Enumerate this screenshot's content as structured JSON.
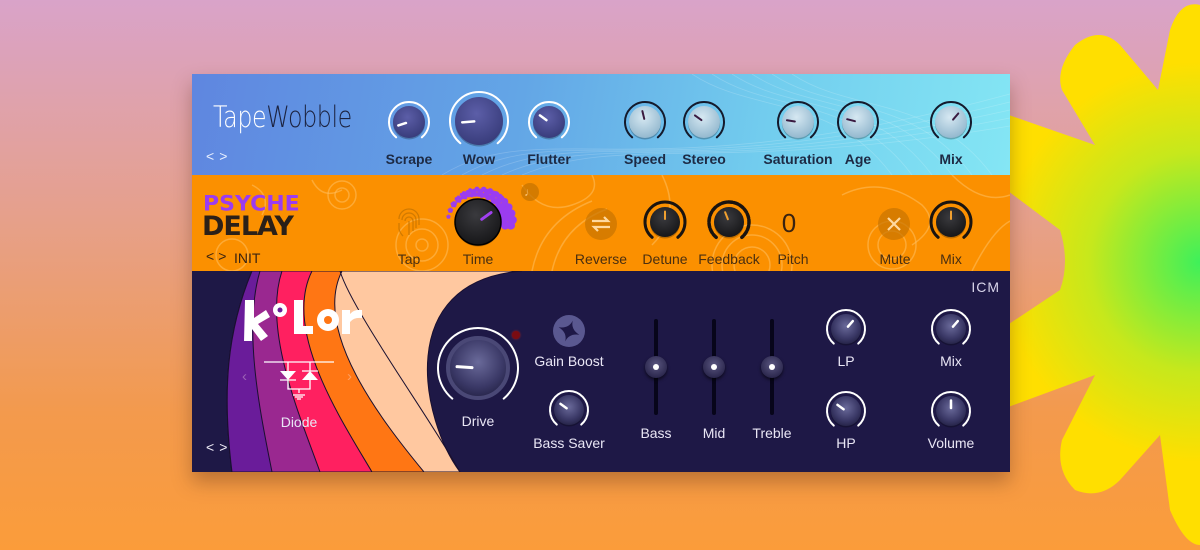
{
  "background": {
    "gradient_top": "#d9a3c9",
    "gradient_bottom": "#fb9c3a",
    "decoration": "yellow-green-star-shape"
  },
  "tapewobble": {
    "title_part1": "Tape",
    "title_part2": "Wobble",
    "nav_prev": "<",
    "nav_next": ">",
    "accent": "#63a6e6",
    "knobs": [
      {
        "id": "scrape",
        "label": "Scrape",
        "value": 0.1
      },
      {
        "id": "wow",
        "label": "Wow",
        "value": 0.15
      },
      {
        "id": "flutter",
        "label": "Flutter",
        "value": 0.3
      },
      {
        "id": "speed",
        "label": "Speed",
        "value": 0.45
      },
      {
        "id": "stereo",
        "label": "Stereo",
        "value": 0.3
      },
      {
        "id": "saturation",
        "label": "Saturation",
        "value": 0.2
      },
      {
        "id": "age",
        "label": "Age",
        "value": 0.22
      },
      {
        "id": "mix",
        "label": "Mix",
        "value": 0.65
      }
    ]
  },
  "psychedelay": {
    "logo_line1": "PSYCHE",
    "logo_line2": "DELAY",
    "preset": "INIT",
    "nav_prev": "<",
    "nav_next": ">",
    "accent": "#fb9000",
    "tap_label": "Tap",
    "time_label": "Time",
    "time_value": 0.7,
    "note_icon": "♩",
    "reverse_label": "Reverse",
    "detune_label": "Detune",
    "detune_value": 0.5,
    "feedback_label": "Feedback",
    "feedback_value": 0.42,
    "pitch_label": "Pitch",
    "pitch_value": "0",
    "mute_label": "Mute",
    "mix_label": "Mix",
    "mix_value": 0.5
  },
  "kolor": {
    "logo": "kOLor",
    "brand": "ICM",
    "mode_label": "Diode",
    "mode_prev": "‹",
    "mode_next": "›",
    "nav_prev": "<",
    "nav_next": ">",
    "accent": "#1e1846",
    "drive_label": "Drive",
    "drive_value": 0.18,
    "gain_boost_label": "Gain Boost",
    "bass_saver_label": "Bass Saver",
    "bass_saver_value": 0.3,
    "sliders": [
      {
        "id": "bass",
        "label": "Bass",
        "value": 0.5
      },
      {
        "id": "mid",
        "label": "Mid",
        "value": 0.5
      },
      {
        "id": "treble",
        "label": "Treble",
        "value": 0.5
      }
    ],
    "lp_label": "LP",
    "lp_value": 0.65,
    "hp_label": "HP",
    "hp_value": 0.3,
    "mix_label": "Mix",
    "mix_value": 0.65,
    "volume_label": "Volume",
    "volume_value": 0.5
  }
}
